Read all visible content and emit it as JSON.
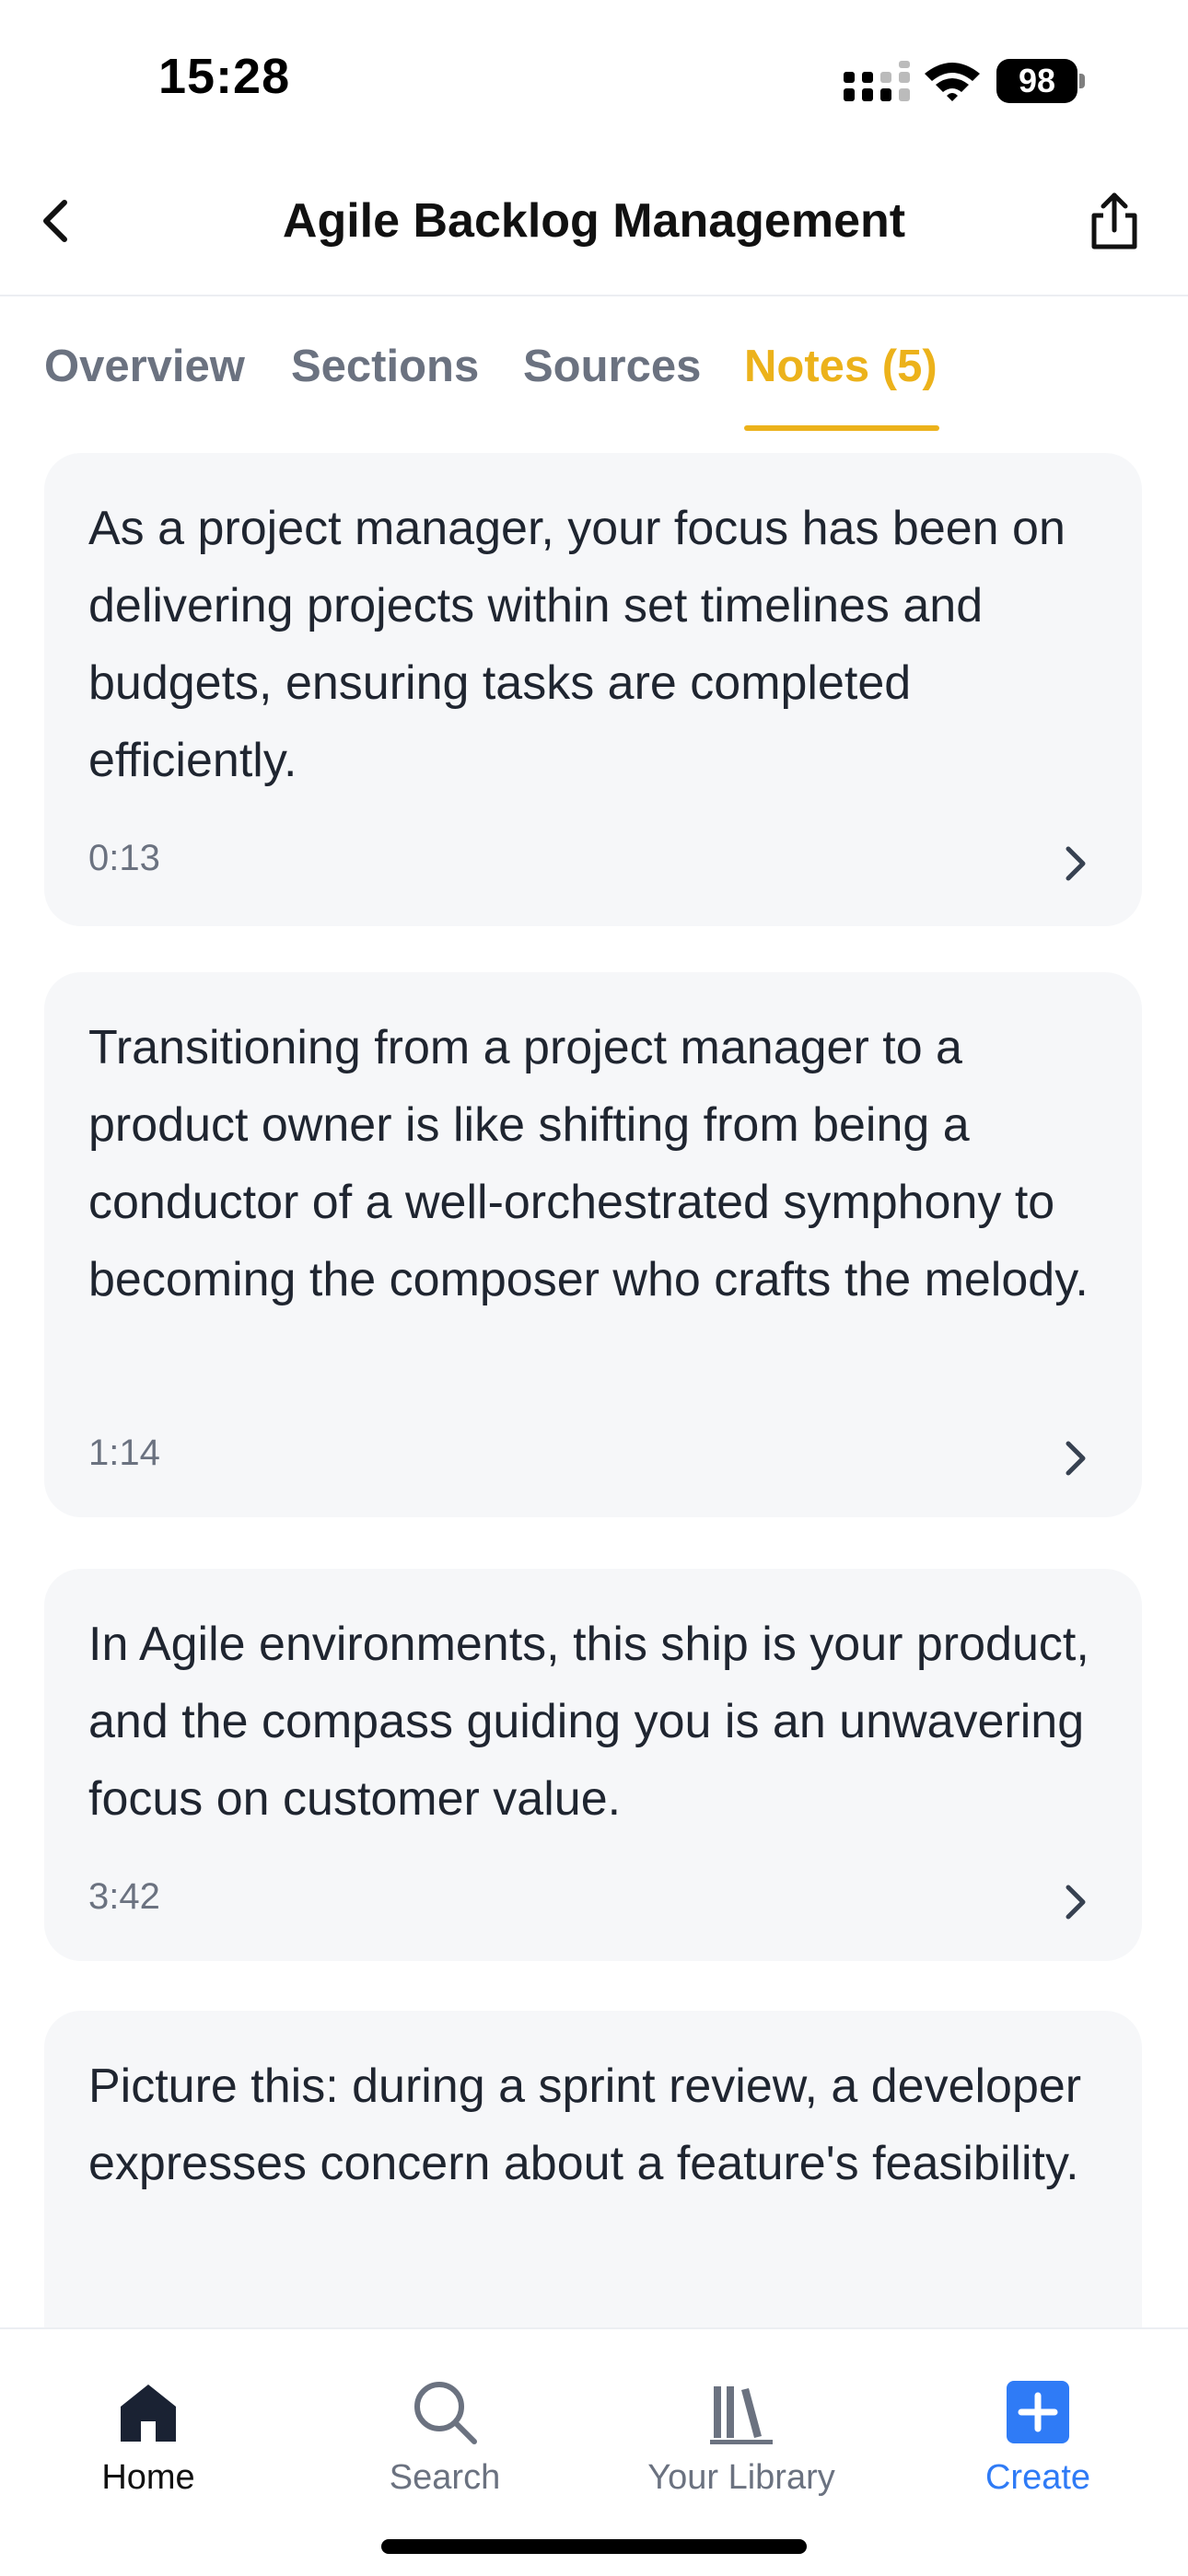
{
  "status_bar": {
    "time": "15:28",
    "battery": "98",
    "icons": [
      "signal-icon",
      "wifi-icon",
      "battery-icon"
    ]
  },
  "header": {
    "title": "Agile Backlog Management",
    "back_icon": "chevron-left-icon",
    "share_icon": "share-icon"
  },
  "tabs": [
    {
      "label": "Overview",
      "active": false
    },
    {
      "label": "Sections",
      "active": false
    },
    {
      "label": "Sources",
      "active": false
    },
    {
      "label": "Notes (5)",
      "active": true
    }
  ],
  "notes": [
    {
      "text": "As a project manager, your focus has been on delivering projects within set timelines and budgets, ensuring tasks are completed efficiently.",
      "time": "0:13"
    },
    {
      "text": "Transitioning from a project manager to a product owner is like shifting from being a conductor of a well-orchestrated symphony to becoming the composer who crafts the melody.",
      "time": "1:14"
    },
    {
      "text": "In Agile environments, this ship is your product, and the compass guiding you is an unwavering focus on customer value.",
      "time": "3:42"
    },
    {
      "text": "Picture this: during a sprint review, a developer expresses concern about a feature's feasibility.",
      "time": ""
    }
  ],
  "tabbar": [
    {
      "label": "Home",
      "icon": "home-icon",
      "active": true
    },
    {
      "label": "Search",
      "icon": "search-icon",
      "active": false
    },
    {
      "label": "Your Library",
      "icon": "library-icon",
      "active": false
    },
    {
      "label": "Create",
      "icon": "plus-icon",
      "active": false
    }
  ],
  "colors": {
    "accent": "#ecb21b",
    "create": "#2f7bf6",
    "card_bg": "#f6f7f9",
    "muted_text": "#6b7280"
  }
}
